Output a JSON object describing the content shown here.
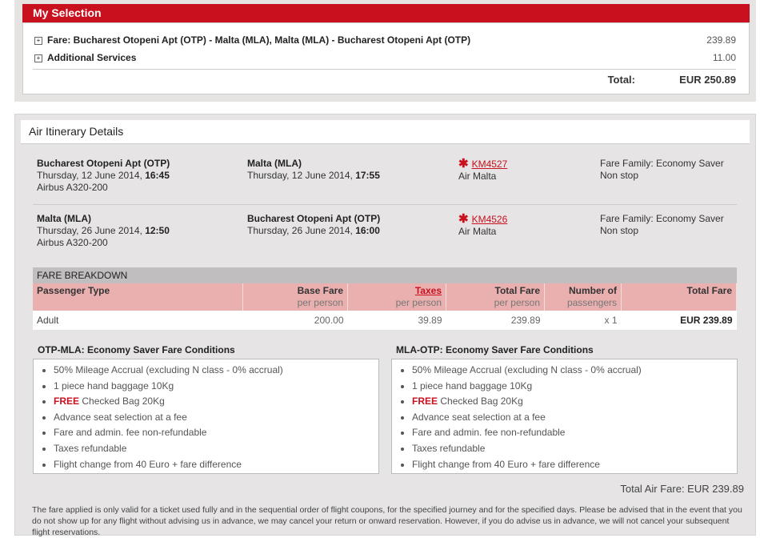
{
  "selection": {
    "title": "My Selection",
    "fare_label": "Fare: Bucharest Otopeni Apt (OTP) - Malta (MLA), Malta (MLA) - Bucharest Otopeni Apt (OTP)",
    "fare_amount": "239.89",
    "services_label": "Additional Services",
    "services_amount": "11.00",
    "total_label": "Total:",
    "total_value": "EUR 250.89"
  },
  "itinerary": {
    "title": "Air Itinerary Details",
    "flights": [
      {
        "from": "Bucharest Otopeni Apt (OTP)",
        "dep_date": "Thursday, 12 June 2014, ",
        "dep_time": "16:45",
        "aircraft": "Airbus A320-200",
        "to": "Malta (MLA)",
        "arr_date": "Thursday, 12 June 2014, ",
        "arr_time": "17:55",
        "flight_no": "KM4527",
        "airline": "Air Malta",
        "fare_family": "Fare Family: Economy Saver",
        "stops": "Non stop"
      },
      {
        "from": "Malta (MLA)",
        "dep_date": "Thursday, 26 June 2014, ",
        "dep_time": "12:50",
        "aircraft": "Airbus A320-200",
        "to": "Bucharest Otopeni Apt (OTP)",
        "arr_date": "Thursday, 26 June 2014, ",
        "arr_time": "16:00",
        "flight_no": "KM4526",
        "airline": "Air Malta",
        "fare_family": "Fare Family: Economy Saver",
        "stops": "Non stop"
      }
    ]
  },
  "fare_breakdown": {
    "title": "FARE BREAKDOWN",
    "headers": [
      {
        "main": "Passenger Type",
        "sub": ""
      },
      {
        "main": "Base Fare",
        "sub": "per person"
      },
      {
        "main": "Taxes",
        "sub": "per person"
      },
      {
        "main": "Total Fare",
        "sub": "per person"
      },
      {
        "main": "Number of",
        "sub": "passengers"
      },
      {
        "main": "Total Fare",
        "sub": ""
      }
    ],
    "row": [
      "Adult",
      "200.00",
      "39.89",
      "239.89",
      "x 1",
      "EUR 239.89"
    ]
  },
  "conditions": [
    {
      "title": "OTP-MLA: Economy Saver Fare Conditions",
      "items": [
        "50% Mileage Accrual (excluding N class - 0% accrual)",
        "1 piece hand baggage 10Kg",
        "Checked Bag 20Kg",
        "Advance seat selection at a fee",
        "Fare and admin. fee non-refundable",
        "Taxes refundable",
        "Flight change from 40 Euro + fare difference"
      ]
    },
    {
      "title": "MLA-OTP: Economy Saver Fare Conditions",
      "items": [
        "50% Mileage Accrual (excluding N class - 0% accrual)",
        "1 piece hand baggage 10Kg",
        "Checked Bag 20Kg",
        "Advance seat selection at a fee",
        "Fare and admin. fee non-refundable",
        "Taxes refundable",
        "Flight change from 40 Euro + fare difference"
      ]
    }
  ],
  "free_label": "FREE",
  "total_air_fare": "Total Air Fare: EUR 239.89",
  "disclaimer": "The fare applied is only valid for a ticket used fully and in the sequential order of flight coupons, for the specified journey and for the specified days. Please be advised that in the event that you do not show up for any flight without advising us in advance, we may cancel your return or onward reservation. However, if you do advise us in advance, we will not cancel your subsequent flight reservations."
}
